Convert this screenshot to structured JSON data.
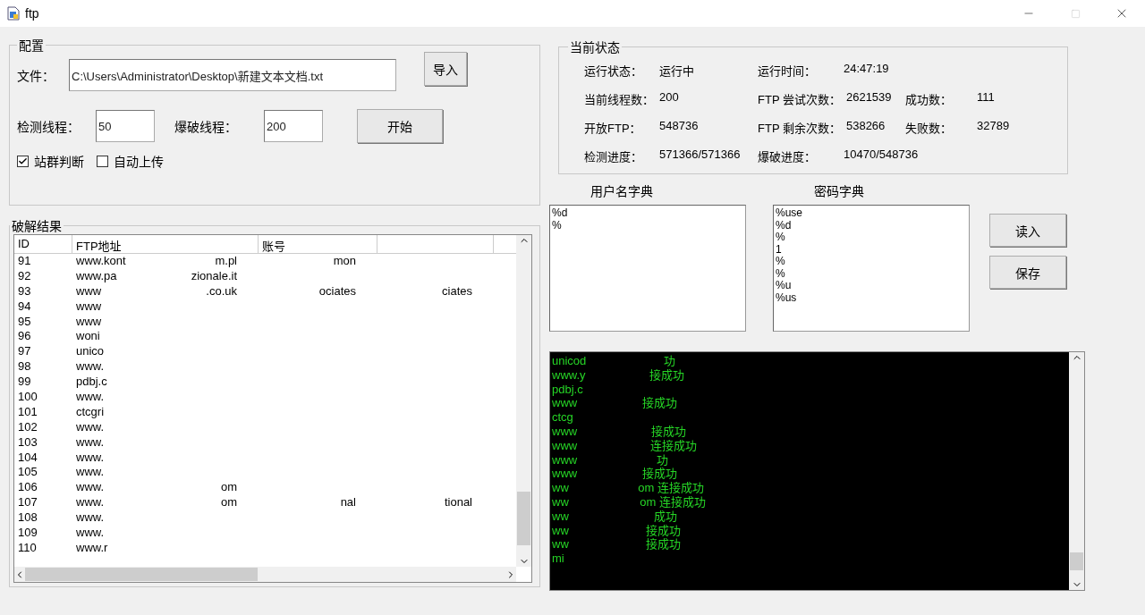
{
  "window": {
    "title": "ftp"
  },
  "config": {
    "title": "配置",
    "file_label": "文件：",
    "file_value": "C:\\Users\\Administrator\\Desktop\\新建文本文档.txt",
    "import_button": "导入",
    "detect_label": "检测线程：",
    "detect_value": "50",
    "brute_label": "爆破线程：",
    "brute_value": "200",
    "start_button": "开始",
    "checkboxes": [
      {
        "label": "站群判断",
        "checked": true
      },
      {
        "label": "自动上传",
        "checked": false
      }
    ]
  },
  "results": {
    "title": "破解结果",
    "columns": [
      {
        "label": "ID"
      },
      {
        "label": "FTP地址"
      },
      {
        "label": "账号"
      },
      {}
    ],
    "rows": [
      {
        "id": "91",
        "address": {
          "start": "www.kont",
          "end": "m.pl"
        },
        "account": {
          "end": "mon"
        }
      },
      {
        "id": "92",
        "address": {
          "start": "www.pa",
          "end": "zionale.it"
        }
      },
      {
        "id": "93",
        "address": {
          "start": "www",
          "end": ".co.uk"
        },
        "account": {
          "end": "ociates"
        },
        "column_4": {
          "end": "ciates"
        }
      },
      {
        "id": "94",
        "address": {
          "start": "www"
        }
      },
      {
        "id": "95",
        "address": {
          "start": "www"
        }
      },
      {
        "id": "96",
        "address": {
          "start": "woni"
        }
      },
      {
        "id": "97",
        "address": {
          "start": "unico"
        }
      },
      {
        "id": "98",
        "address": {
          "start": "www."
        }
      },
      {
        "id": "99",
        "address": {
          "start": "pdbj.c"
        }
      },
      {
        "id": "100",
        "address": {
          "start": "www."
        }
      },
      {
        "id": "101",
        "address": {
          "start": "ctcgri"
        }
      },
      {
        "id": "102",
        "address": {
          "start": "www."
        }
      },
      {
        "id": "103",
        "address": {
          "start": "www."
        }
      },
      {
        "id": "104",
        "address": {
          "start": "www."
        }
      },
      {
        "id": "105",
        "address": {
          "start": "www."
        }
      },
      {
        "id": "106",
        "address": {
          "start": "www.",
          "end": "om"
        }
      },
      {
        "id": "107",
        "address": {
          "start": "www.",
          "end": "om"
        },
        "account": {
          "end": "nal"
        },
        "column_4": {
          "end": "tional"
        }
      },
      {
        "id": "108",
        "address": {
          "start": "www."
        }
      },
      {
        "id": "109",
        "address": {
          "start": "www."
        }
      },
      {
        "id": "110",
        "address": {
          "start": "www.r"
        }
      }
    ]
  },
  "status": {
    "title": "当前状态",
    "rows": [
      [
        {
          "label": "运行状态：",
          "value": "运行中"
        },
        {
          "label": "运行时间：",
          "value": "24:47:19"
        }
      ],
      [
        {
          "label": "当前线程数：",
          "value": "200"
        },
        {
          "label": "FTP 尝试次数：",
          "value": "2621539"
        },
        {
          "label": "成功数：",
          "value": "111"
        }
      ],
      [
        {
          "label": "开放FTP：",
          "value": "548736"
        },
        {
          "label": "FTP 剩余次数：",
          "value": "538266"
        },
        {
          "label": "失败数：",
          "value": "32789"
        }
      ],
      [
        {
          "label": "检测进度：",
          "value": "571366/571366"
        },
        {
          "label": "爆破进度：",
          "value": "10470/548736"
        }
      ]
    ]
  },
  "username_dict": {
    "title": "用户名字典",
    "lines": [
      "%d",
      "%"
    ]
  },
  "password_dict": {
    "title": "密码字典",
    "lines": [
      "%use",
      "%d",
      "%",
      "1",
      "%",
      "%",
      "%u",
      "%us"
    ]
  },
  "dict_buttons": [
    "读入",
    "保存"
  ],
  "log": {
    "lines": [
      {
        "start": "unicod",
        "end": "功"
      },
      {
        "start": "www.y",
        "end": "接成功"
      },
      {
        "start": "pdbj.c"
      },
      {
        "start": "www",
        "end": "接成功"
      },
      {
        "start": "ctcg"
      },
      {
        "start": "www",
        "end": "接成功"
      },
      {
        "start": "www",
        "end": "连接成功"
      },
      {
        "start": "www",
        "end": "功"
      },
      {
        "start": "www",
        "end": "接成功"
      },
      {
        "start": "ww",
        "end": "om  连接成功"
      },
      {
        "start": "ww",
        "end": "om  连接成功"
      },
      {
        "start": "ww",
        "end": "成功"
      },
      {
        "start": "ww",
        "end": "接成功"
      },
      {
        "start": "ww",
        "end": "接成功"
      },
      {
        "start": "mi"
      }
    ]
  }
}
